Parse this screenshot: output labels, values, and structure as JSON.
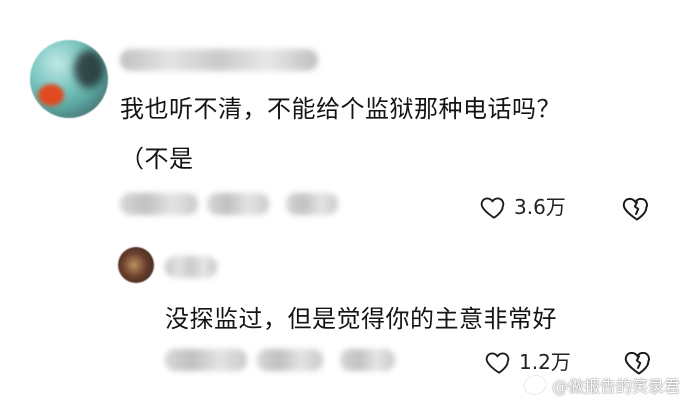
{
  "comments": [
    {
      "text_line1": "我也听不清，不能给个监狱那种电话吗？",
      "text_line2": "（不是",
      "likes": "3.6万"
    },
    {
      "text_line1": "没探监过，但是觉得你的主意非常好",
      "likes": "1.2万"
    }
  ],
  "icons": {
    "like": "heart-outline-icon",
    "dislike": "broken-heart-outline-icon"
  },
  "watermark": "@做报告的笑录君"
}
